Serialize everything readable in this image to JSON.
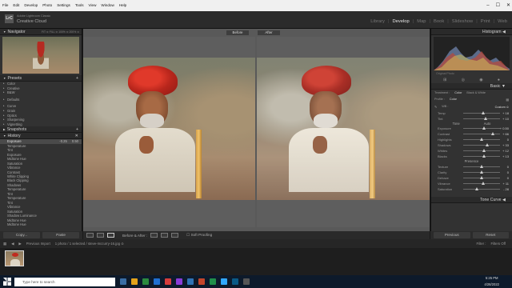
{
  "menubar": [
    "File",
    "Edit",
    "Develop",
    "Photo",
    "Settings",
    "Tools",
    "View",
    "Window",
    "Help"
  ],
  "window_controls": [
    "–",
    "☐",
    "✕"
  ],
  "identity": {
    "logo": "LrC",
    "line1": "Adobe Lightroom Classic",
    "line2": "Creative Cloud"
  },
  "modules": [
    "Library",
    "Develop",
    "Map",
    "Book",
    "Slideshow",
    "Print",
    "Web"
  ],
  "active_module": "Develop",
  "left": {
    "navigator": "Navigator",
    "nav_fit": "FIT ≎",
    "nav_fill": "FILL ≎",
    "nav_zoom": "100% ≎",
    "nav_zoom2": "200% ≎",
    "presets_title": "Presets",
    "presets": [
      "Color",
      "Creative",
      "B&W",
      "Defaults",
      "Curve",
      "Grain",
      "Optics",
      "Sharpening",
      "Vignetting"
    ],
    "snapshots_title": "Snapshots",
    "history_title": "History",
    "history": [
      {
        "name": "Exposure",
        "a": "-0.25",
        "b": "0.50",
        "sel": true
      },
      {
        "name": "Temperature",
        "a": "",
        "b": ""
      },
      {
        "name": "Tint",
        "a": "",
        "b": ""
      },
      {
        "name": "Exposure",
        "a": "",
        "b": ""
      },
      {
        "name": "Midtone Hue",
        "a": "",
        "b": ""
      },
      {
        "name": "Saturation",
        "a": "",
        "b": ""
      },
      {
        "name": "Vibrance",
        "a": "",
        "b": ""
      },
      {
        "name": "Contrast",
        "a": "",
        "b": ""
      },
      {
        "name": "White Clipping",
        "a": "",
        "b": ""
      },
      {
        "name": "Black Clipping",
        "a": "",
        "b": ""
      },
      {
        "name": "Shadows",
        "a": "",
        "b": ""
      },
      {
        "name": "Temperature",
        "a": "",
        "b": ""
      },
      {
        "name": "Tint",
        "a": "",
        "b": ""
      },
      {
        "name": "Temperature",
        "a": "",
        "b": ""
      },
      {
        "name": "Tint",
        "a": "",
        "b": ""
      },
      {
        "name": "Vibrance",
        "a": "",
        "b": ""
      },
      {
        "name": "Saturation",
        "a": "",
        "b": ""
      },
      {
        "name": "Shadow Luminance",
        "a": "",
        "b": ""
      },
      {
        "name": "Midtone Hue",
        "a": "",
        "b": ""
      },
      {
        "name": "Midtone Hue",
        "a": "",
        "b": ""
      }
    ],
    "copy": "Copy...",
    "paste": "Paste"
  },
  "center": {
    "before": "Before",
    "after": "After",
    "before_after": "Before & After :",
    "soft_proofing": "Soft Proofing"
  },
  "right": {
    "histogram": "Histogram",
    "original_photo": "Original Photo",
    "basic": "Basic",
    "treatment_label": "Treatment :",
    "color": "Color",
    "bw": "Black & White",
    "profile_label": "Profile :",
    "profile_value": "Color",
    "wb_label": "WB :",
    "wb_value": "Custom ≎",
    "temp": {
      "name": "Temp",
      "value": "+ 18",
      "pos": 0.55
    },
    "tint": {
      "name": "Tint",
      "value": "+ 10",
      "pos": 0.6
    },
    "tone": "Tone",
    "auto": "Auto",
    "exposure": {
      "name": "Exposure",
      "value": "+ 0.50",
      "pos": 0.57
    },
    "contrast": {
      "name": "Contrast",
      "value": "+ 66",
      "pos": 0.8
    },
    "highlights": {
      "name": "Highlights",
      "value": "0",
      "pos": 0.5
    },
    "shadows": {
      "name": "Shadows",
      "value": "+ 33",
      "pos": 0.66
    },
    "whites": {
      "name": "Whites",
      "value": "+ 12",
      "pos": 0.56
    },
    "blacks": {
      "name": "Blacks",
      "value": "+ 13",
      "pos": 0.57
    },
    "presence": "Presence",
    "texture": {
      "name": "Texture",
      "value": "0",
      "pos": 0.5
    },
    "clarity": {
      "name": "Clarity",
      "value": "0",
      "pos": 0.5
    },
    "dehaze": {
      "name": "Dehaze",
      "value": "0",
      "pos": 0.5
    },
    "vibrance": {
      "name": "Vibrance",
      "value": "+ 11",
      "pos": 0.55
    },
    "saturation": {
      "name": "Saturation",
      "value": "- 28",
      "pos": 0.36
    },
    "tone_curve": "Tone Curve",
    "previous": "Previous",
    "reset": "Reset"
  },
  "filmstrip": {
    "header": "Previous Import",
    "info": "1 photo / 1 selected / steve-mccurry-16.jpg ≎",
    "filter_label": "Filter :",
    "filter_value": "Filters Off"
  },
  "taskbar": {
    "search": "Type here to search",
    "time": "5:25 PM",
    "date": "4/28/2022"
  },
  "colors": {
    "accent_text": "#e6e6e6",
    "panel": "#323232",
    "selection": "#4a4a4a"
  }
}
